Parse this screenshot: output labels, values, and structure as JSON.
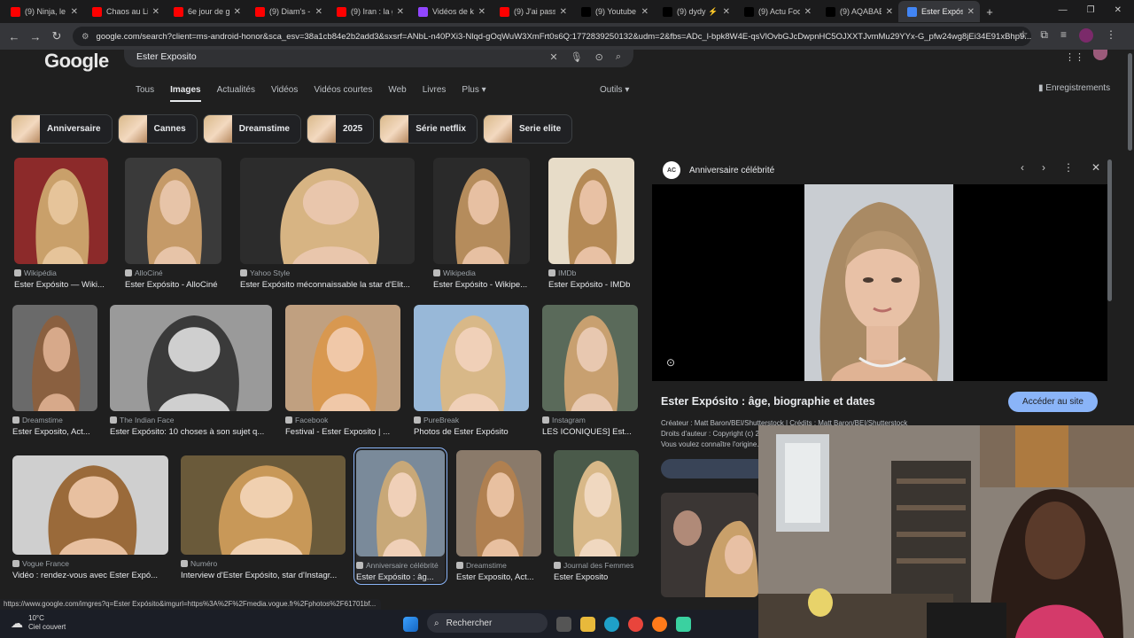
{
  "browser": {
    "tabs": [
      {
        "label": "(9) Ninja, le ...",
        "fav": "#ff0000"
      },
      {
        "label": "Chaos au Lib...",
        "fav": "#ff0000"
      },
      {
        "label": "6e jour de g...",
        "fav": "#ff0000"
      },
      {
        "label": "(9) Diam's - ...",
        "fav": "#ff0000"
      },
      {
        "label": "(9) Iran : la g...",
        "fav": "#ff0000"
      },
      {
        "label": "Vidéos de k...",
        "fav": "#9146ff"
      },
      {
        "label": "(9) J'ai passé...",
        "fav": "#ff0000"
      },
      {
        "label": "(9) Youtube ...",
        "fav": "#000000"
      },
      {
        "label": "(9) dydy ⚡...",
        "fav": "#000000"
      },
      {
        "label": "(9) Actu Foo...",
        "fav": "#000000"
      },
      {
        "label": "(9) AQABABI...",
        "fav": "#000000"
      },
      {
        "label": "Ester Expósi...",
        "fav": "#4285f4",
        "active": true
      }
    ],
    "url": "google.com/search?client=ms-android-honor&sca_esv=38a1cb84e2b2add3&sxsrf=ANbL-n40PXi3-Nlqd-gOqWuW3XmFrt0s6Q:1772839250132&udm=2&fbs=ADc_l-bpk8W4E-qsVlOvbGJcDwpnHC5OJXXTJvmMu29YYx-G_pfw24wg8jEi34E91xBhp9..."
  },
  "search": {
    "logo": "Google",
    "query": "Ester Exposito",
    "tabs": [
      "Tous",
      "Images",
      "Actualités",
      "Vidéos",
      "Vidéos courtes",
      "Web",
      "Livres",
      "Plus ▾"
    ],
    "selected_tab": "Images",
    "tools": "Outils ▾",
    "saved": "Enregistrements",
    "chips": [
      "Anniversaire",
      "Cannes",
      "Dreamstime",
      "2025",
      "Série netflix",
      "Serie elite"
    ]
  },
  "results": [
    {
      "source": "Wikipédia",
      "caption": "Ester Expósito — Wiki..."
    },
    {
      "source": "AlloCiné",
      "caption": "Ester Expósito - AlloCiné"
    },
    {
      "source": "Yahoo Style",
      "caption": "Ester Expósito méconnaissable la star d'Elit..."
    },
    {
      "source": "Wikipedia",
      "caption": "Ester Expósito - Wikipe..."
    },
    {
      "source": "IMDb",
      "caption": "Ester Expósito - IMDb"
    },
    {
      "source": "Dreamstime",
      "caption": "Ester Exposito, Act..."
    },
    {
      "source": "The Indian Face",
      "caption": "Ester Expósito: 10 choses à son sujet q..."
    },
    {
      "source": "Facebook",
      "caption": "Festival - Ester Exposito | ..."
    },
    {
      "source": "PureBreak",
      "caption": "Photos de Ester Expósito"
    },
    {
      "source": "Instagram",
      "caption": "LES ICONIQUES] Est..."
    },
    {
      "source": "Vogue France",
      "caption": "Vidéo : rendez-vous avec Ester Expó..."
    },
    {
      "source": "Numéro",
      "caption": "Interview d'Ester Expósito, star d'Instagr..."
    },
    {
      "source": "Anniversaire célébrité",
      "caption": "Ester Expósito : âg..."
    },
    {
      "source": "Dreamstime",
      "caption": "Ester Exposito, Act..."
    },
    {
      "source": "Journal des Femmes",
      "caption": "Ester Exposito"
    }
  ],
  "panel": {
    "site_logo": "AC",
    "site": "Anniversaire célébrité",
    "title": "Ester Expósito : âge, biographie et dates",
    "visit": "Accéder au site",
    "meta1": "Créateur : Matt Baron/BEI/Shutterstock | Crédits : Matt Baron/BEI/Shutterstock",
    "meta2": "Droits d'auteur : Copyright (c) 2...",
    "meta3": "Vous voulez connaître l'origine..."
  },
  "status_url": "https://www.google.com/imgres?q=Ester Expósito&imgurl=https%3A%2F%2Fmedia.vogue.fr%2Fphotos%2F61701bf...",
  "taskbar": {
    "temp": "10°C",
    "weather": "Ciel couvert",
    "search": "Rechercher"
  }
}
